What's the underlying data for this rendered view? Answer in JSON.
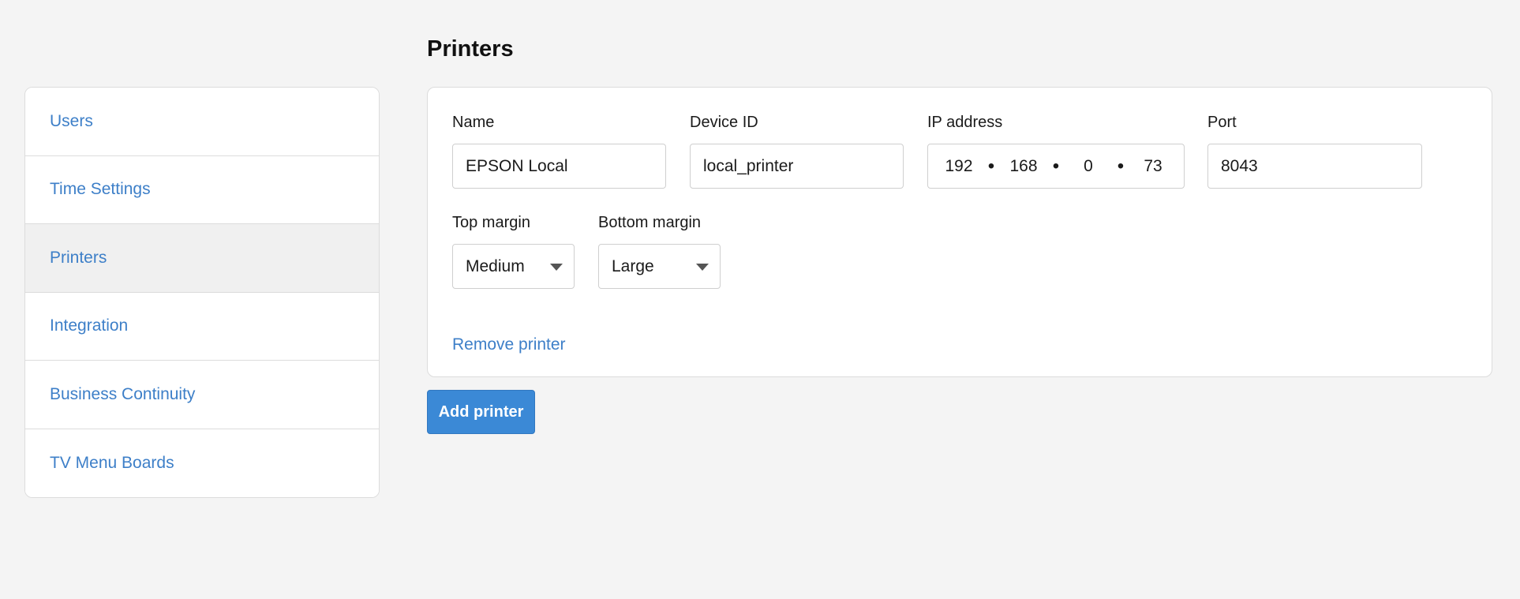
{
  "sidebar": {
    "items": [
      {
        "label": "Users"
      },
      {
        "label": "Time Settings"
      },
      {
        "label": "Printers"
      },
      {
        "label": "Integration"
      },
      {
        "label": "Business Continuity"
      },
      {
        "label": "TV Menu Boards"
      }
    ],
    "active_index": 2
  },
  "page": {
    "title": "Printers"
  },
  "printer": {
    "name_label": "Name",
    "name_value": "EPSON Local",
    "device_id_label": "Device ID",
    "device_id_value": "local_printer",
    "ip_label": "IP address",
    "ip_octets": [
      "192",
      "168",
      "0",
      "73"
    ],
    "port_label": "Port",
    "port_value": "8043",
    "top_margin_label": "Top margin",
    "top_margin_value": "Medium",
    "bottom_margin_label": "Bottom margin",
    "bottom_margin_value": "Large",
    "remove_label": "Remove printer"
  },
  "actions": {
    "add_printer_label": "Add printer"
  },
  "colors": {
    "link": "#3d7fc8",
    "primary_button": "#3b89d6",
    "background": "#f4f4f4",
    "active_item": "#f0f0f0"
  },
  "icons": {
    "select_caret": "caret-down-icon",
    "ip_separator": "dot-separator-icon"
  }
}
